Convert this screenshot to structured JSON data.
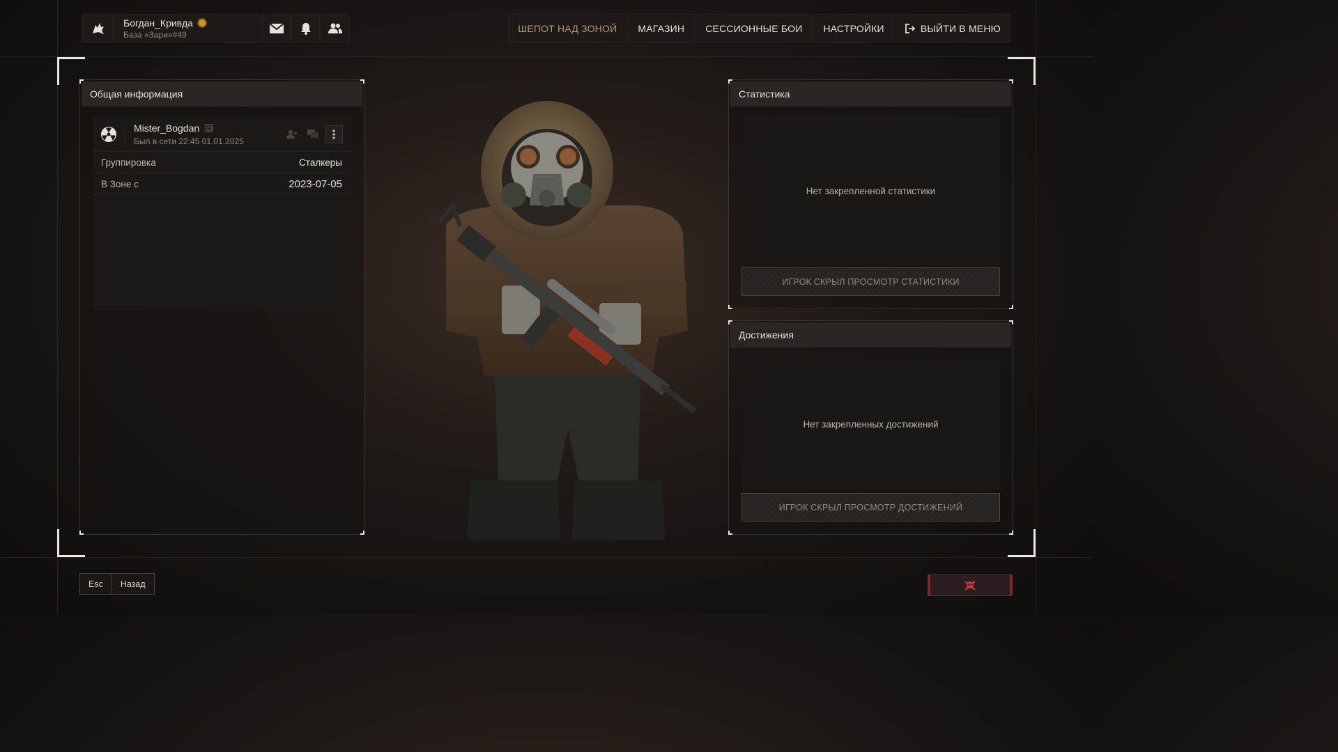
{
  "topbar": {
    "user": {
      "name": "Богдан_Кривда",
      "base": "База «Зари»#49"
    },
    "icons": [
      "mail-icon",
      "bell-icon",
      "friends-icon"
    ],
    "nav": [
      {
        "label": "ШЕПОТ НАД ЗОНОЙ",
        "active": true
      },
      {
        "label": "МАГАЗИН",
        "active": false
      },
      {
        "label": "СЕССИОННЫЕ БОИ",
        "active": false
      },
      {
        "label": "НАСТРОЙКИ",
        "active": false
      }
    ],
    "exit_label": "ВЫЙТИ В МЕНЮ"
  },
  "general": {
    "title": "Общая информация",
    "player": {
      "name": "Mister_Bogdan",
      "last_seen": "Был в сети 22:45 01.01.2025"
    },
    "rows": [
      {
        "key": "Группировка",
        "value": "Сталкеры"
      },
      {
        "key": "В Зоне с",
        "value": "2023-07-05"
      }
    ]
  },
  "stats": {
    "title": "Статистика",
    "empty": "Нет закрепленной статистики",
    "hidden": "ИГРОК СКРЫЛ ПРОСМОТР СТАТИСТИКИ"
  },
  "achievements": {
    "title": "Достижения",
    "empty": "Нет закрепленных достижений",
    "hidden": "ИГРОК СКРЫЛ ПРОСМОТР ДОСТИЖЕНИЙ"
  },
  "footer": {
    "key": "Esc",
    "back": "Назад"
  },
  "colors": {
    "accent": "#b3967a",
    "danger": "#d0343c"
  }
}
